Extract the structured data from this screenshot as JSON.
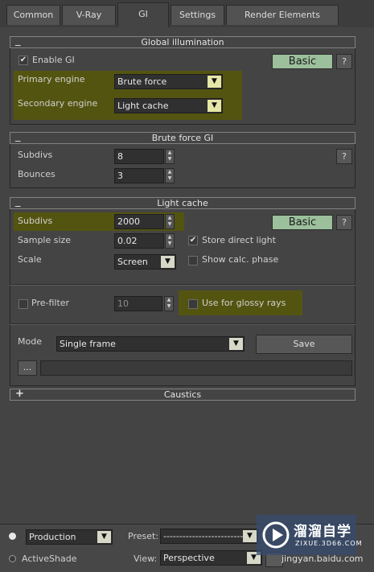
{
  "tabs": [
    "Common",
    "V-Ray",
    "GI",
    "Settings",
    "Render Elements"
  ],
  "gi": {
    "header": "Global illumination",
    "enable_label": "Enable GI",
    "enable_checked": true,
    "mode_button": "Basic",
    "help": "?",
    "primary_label": "Primary engine",
    "primary_value": "Brute force",
    "secondary_label": "Secondary engine",
    "secondary_value": "Light cache"
  },
  "brute": {
    "header": "Brute force GI",
    "subdivs_label": "Subdivs",
    "subdivs_value": "8",
    "bounces_label": "Bounces",
    "bounces_value": "3",
    "help": "?"
  },
  "lightcache": {
    "header": "Light cache",
    "subdivs_label": "Subdivs",
    "subdivs_value": "2000",
    "sample_label": "Sample size",
    "sample_value": "0.02",
    "scale_label": "Scale",
    "scale_value": "Screen",
    "mode_button": "Basic",
    "help": "?",
    "store_label": "Store direct light",
    "store_checked": true,
    "show_label": "Show calc. phase",
    "prefilter_label": "Pre-filter",
    "prefilter_value": "10",
    "glossy_label": "Use for glossy rays",
    "mode_label": "Mode",
    "mode_value": "Single frame",
    "save_button": "Save",
    "browse_button": "..."
  },
  "caustics": {
    "header": "Caustics"
  },
  "bottom": {
    "production_label": "Production",
    "activeshade_label": "ActiveShade",
    "preset_label": "Preset:",
    "preset_value": "--------------------------",
    "view_label": "View:",
    "view_value": "Perspective",
    "watermark_cn": "溜溜自学",
    "watermark_url": "ZIXUE.3D66.COM",
    "watermark_behind": "jingyan.baidu.com"
  }
}
